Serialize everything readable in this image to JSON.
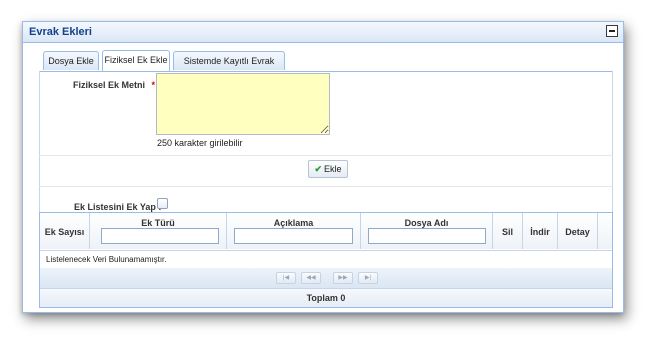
{
  "panel": {
    "title": "Evrak Ekleri"
  },
  "tabs": [
    {
      "label": "Dosya Ekle"
    },
    {
      "label": "Fiziksel Ek Ekle"
    },
    {
      "label": "Sistemde Kayıtlı Evrak Ekle"
    }
  ],
  "form": {
    "metin_label": "Fiziksel Ek Metni",
    "required_marker": "*",
    "colon": ":",
    "metin_value": "",
    "char_hint": "250 karakter girilebilir",
    "ekle_button": "Ekle",
    "ek_listesi_label": "Ek Listesini Ek Yap :"
  },
  "grid": {
    "columns": [
      "Ek Sayısı",
      "Ek Türü",
      "Açıklama",
      "Dosya Adı",
      "Sil",
      "İndir",
      "Detay"
    ],
    "empty_text": "Listelenecek Veri Bulunamamıştır.",
    "pager": [
      "|◀",
      "◀◀",
      "▶▶",
      "▶|"
    ],
    "footer": "Toplam 0"
  }
}
